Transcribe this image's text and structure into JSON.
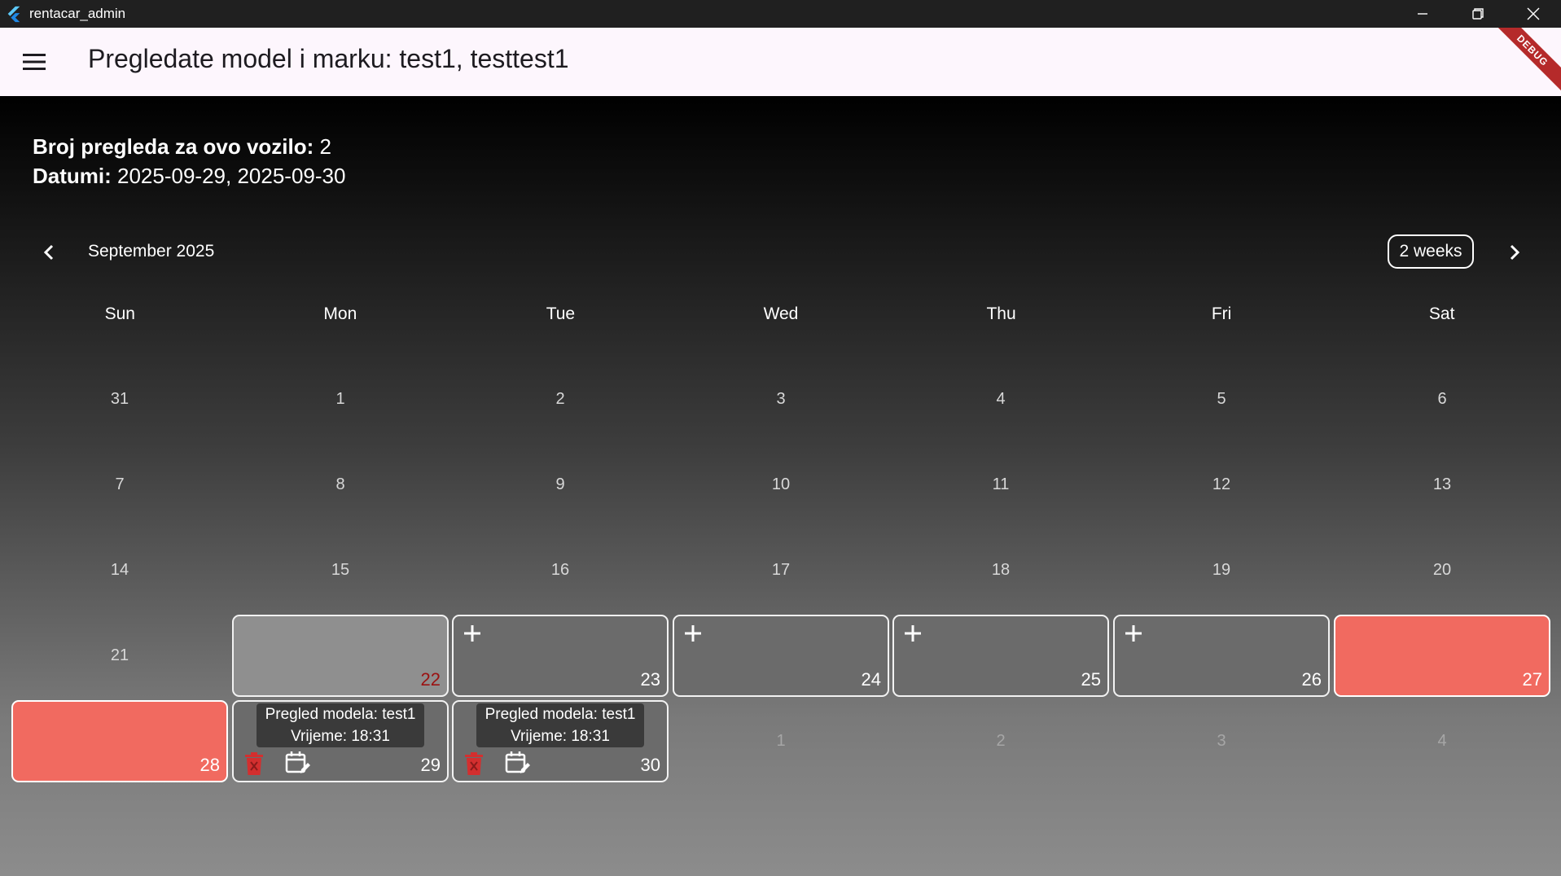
{
  "window": {
    "title": "rentacar_admin",
    "icon": "flutter-icon"
  },
  "appbar": {
    "title": "Pregledate model i marku: test1, testtest1",
    "debug_label": "DEBUG"
  },
  "info": {
    "count_label": "Broj pregleda za ovo vozilo:",
    "count_value": "2",
    "dates_label": "Datumi:",
    "dates_value": "2025-09-29, 2025-09-30"
  },
  "calendar": {
    "month": "September 2025",
    "format_button": "2 weeks",
    "days_of_week": [
      "Sun",
      "Mon",
      "Tue",
      "Wed",
      "Thu",
      "Fri",
      "Sat"
    ],
    "weeks": [
      [
        "31",
        "1",
        "2",
        "3",
        "4",
        "5",
        "6"
      ],
      [
        "7",
        "8",
        "9",
        "10",
        "11",
        "12",
        "13"
      ],
      [
        "14",
        "15",
        "16",
        "17",
        "18",
        "19",
        "20"
      ],
      [
        "21",
        "22",
        "23",
        "24",
        "25",
        "26",
        "27"
      ],
      [
        "28",
        "29",
        "30",
        "1",
        "2",
        "3",
        "4"
      ]
    ],
    "events": {
      "29": {
        "line1": "Pregled modela: test1",
        "line2": "Vrijeme: 18:31"
      },
      "30": {
        "line1": "Pregled modela: test1",
        "line2": "Vrijeme: 18:31"
      }
    },
    "colors": {
      "booked": "#f16a60",
      "available": "#6b6b6b",
      "disabled": "#8f8f8f",
      "delete_icon": "#d32f2f"
    }
  }
}
